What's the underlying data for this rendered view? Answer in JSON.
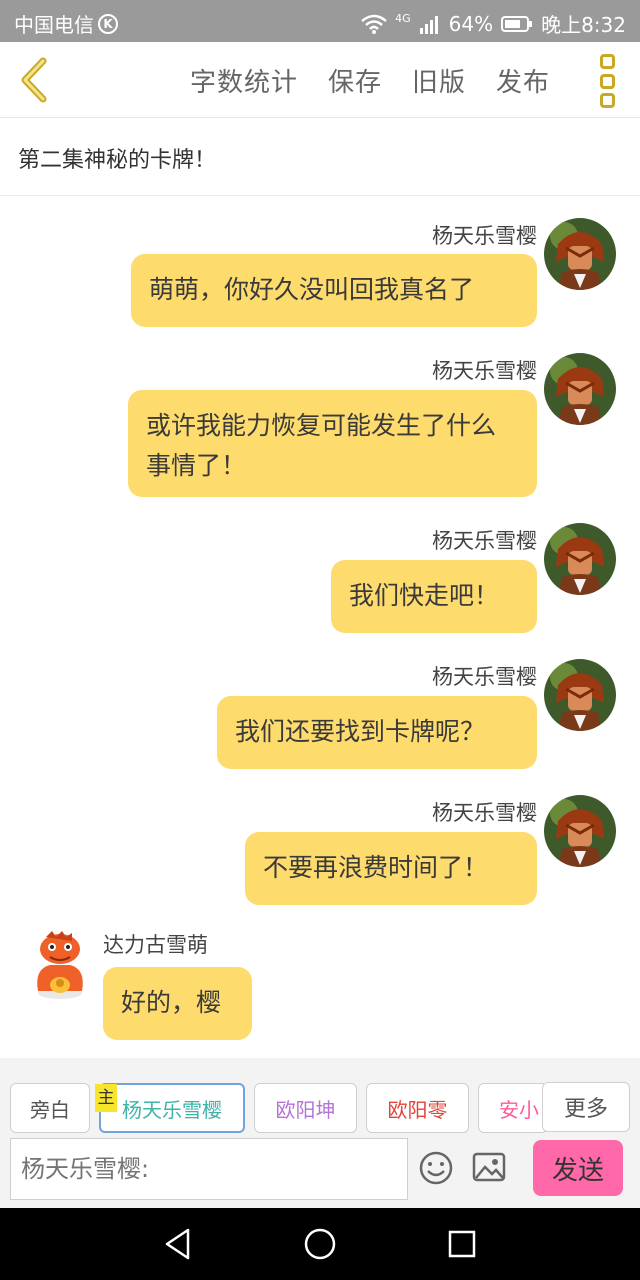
{
  "status_bar": {
    "carrier": "中国电信",
    "carrier_badge": "K",
    "network": "4G",
    "battery": "64%",
    "time": "晚上8:32"
  },
  "toolbar": {
    "actions": [
      "字数统计",
      "保存",
      "旧版",
      "发布"
    ],
    "back_icon": "chevron-left-icon",
    "more_icon": "more-vertical-icon",
    "accent_color": "#c9a826"
  },
  "story": {
    "title": "第二集神秘的卡牌！"
  },
  "messages": [
    {
      "side": "right",
      "name": "杨天乐雪樱",
      "text": "萌萌，你好久没叫回我真名了"
    },
    {
      "side": "right",
      "name": "杨天乐雪樱",
      "text": "或许我能力恢复可能发生了什么事情了！"
    },
    {
      "side": "right",
      "name": "杨天乐雪樱",
      "text": "我们快走吧！"
    },
    {
      "side": "right",
      "name": "杨天乐雪樱",
      "text": "我们还要找到卡牌呢？"
    },
    {
      "side": "right",
      "name": "杨天乐雪樱",
      "text": "不要再浪费时间了！"
    },
    {
      "side": "left",
      "name": "达力古雪萌",
      "text": "好的，樱"
    }
  ],
  "bubble_color": "#fddb6d",
  "characters": {
    "chips": [
      {
        "label": "旁白",
        "color": "#555555"
      },
      {
        "label": "杨天乐雪樱",
        "color": "#3cb4a8"
      },
      {
        "label": "欧阳坤",
        "color": "#b473d6"
      },
      {
        "label": "欧阳零",
        "color": "#e0443a"
      },
      {
        "label": "安小",
        "color": "#ff5a9b"
      }
    ],
    "main_tag": "主",
    "more_label": "更多"
  },
  "composer": {
    "placeholder": "杨天乐雪樱:",
    "emoji_icon": "smiley-icon",
    "image_icon": "image-icon",
    "send_label": "发送",
    "send_color": "#ff69a9"
  },
  "nav": {
    "icons": [
      "back-triangle-icon",
      "home-circle-icon",
      "recents-square-icon"
    ]
  }
}
